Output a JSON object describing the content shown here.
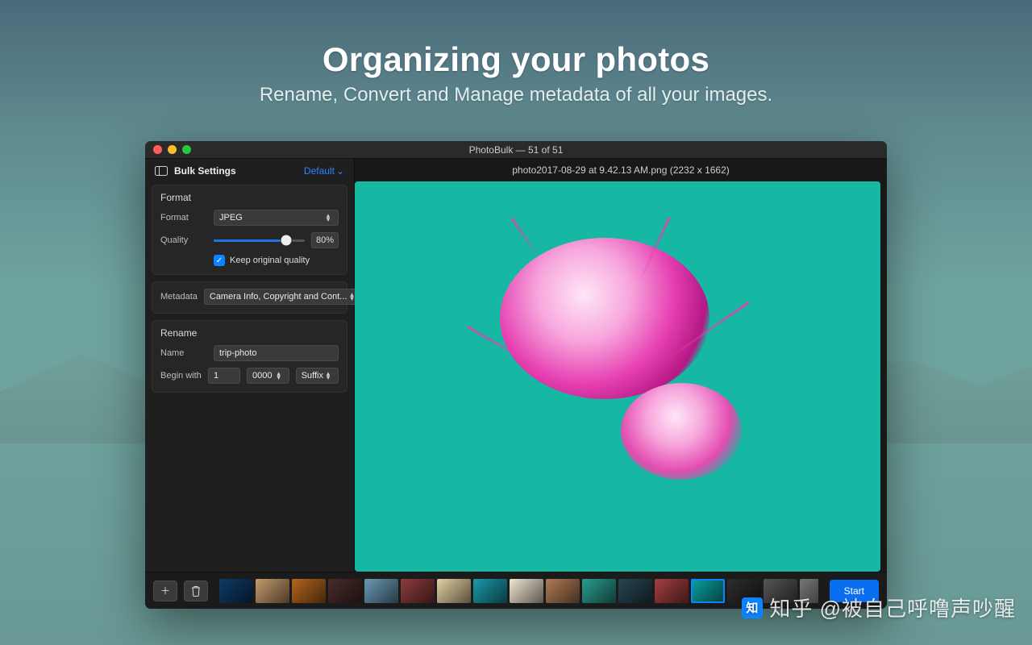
{
  "hero": {
    "title": "Organizing your photos",
    "subtitle": "Rename, Convert and Manage metadata of all your images."
  },
  "window": {
    "title": "PhotoBulk — 51 of 51"
  },
  "sidebar": {
    "heading": "Bulk Settings",
    "preset": "Default",
    "format_section": {
      "title": "Format",
      "format_label": "Format",
      "format_value": "JPEG",
      "quality_label": "Quality",
      "quality_pct": "80%",
      "keep_original": "Keep original quality"
    },
    "metadata_section": {
      "title": "Metadata",
      "value": "Camera Info, Copyright and Cont..."
    },
    "rename_section": {
      "title": "Rename",
      "name_label": "Name",
      "name_value": "trip-photo",
      "begin_label": "Begin with",
      "begin_value": "1",
      "digits_value": "0000",
      "position_value": "Suffix"
    }
  },
  "main": {
    "filename": "photo2017-08-29 at 9.42.13 AM.png (2232 x 1662)"
  },
  "footer": {
    "start": "Start"
  },
  "thumbs": [
    "#0d3b66",
    "#c49a6c",
    "#b5651d",
    "#4a2c2a",
    "#6a99b5",
    "#8e3c3c",
    "#e5d1a1",
    "#1b9aaa",
    "#f0e6d2",
    "#b07c54",
    "#2a9d8f",
    "#264653",
    "#a63f3f",
    "#0aa3a3",
    "#2d2d2d",
    "#555",
    "#777",
    "#c7a06b",
    "#ffb703"
  ],
  "thumb_selected_index": 13,
  "watermark": "知乎  @被自己呼噜声吵醒"
}
